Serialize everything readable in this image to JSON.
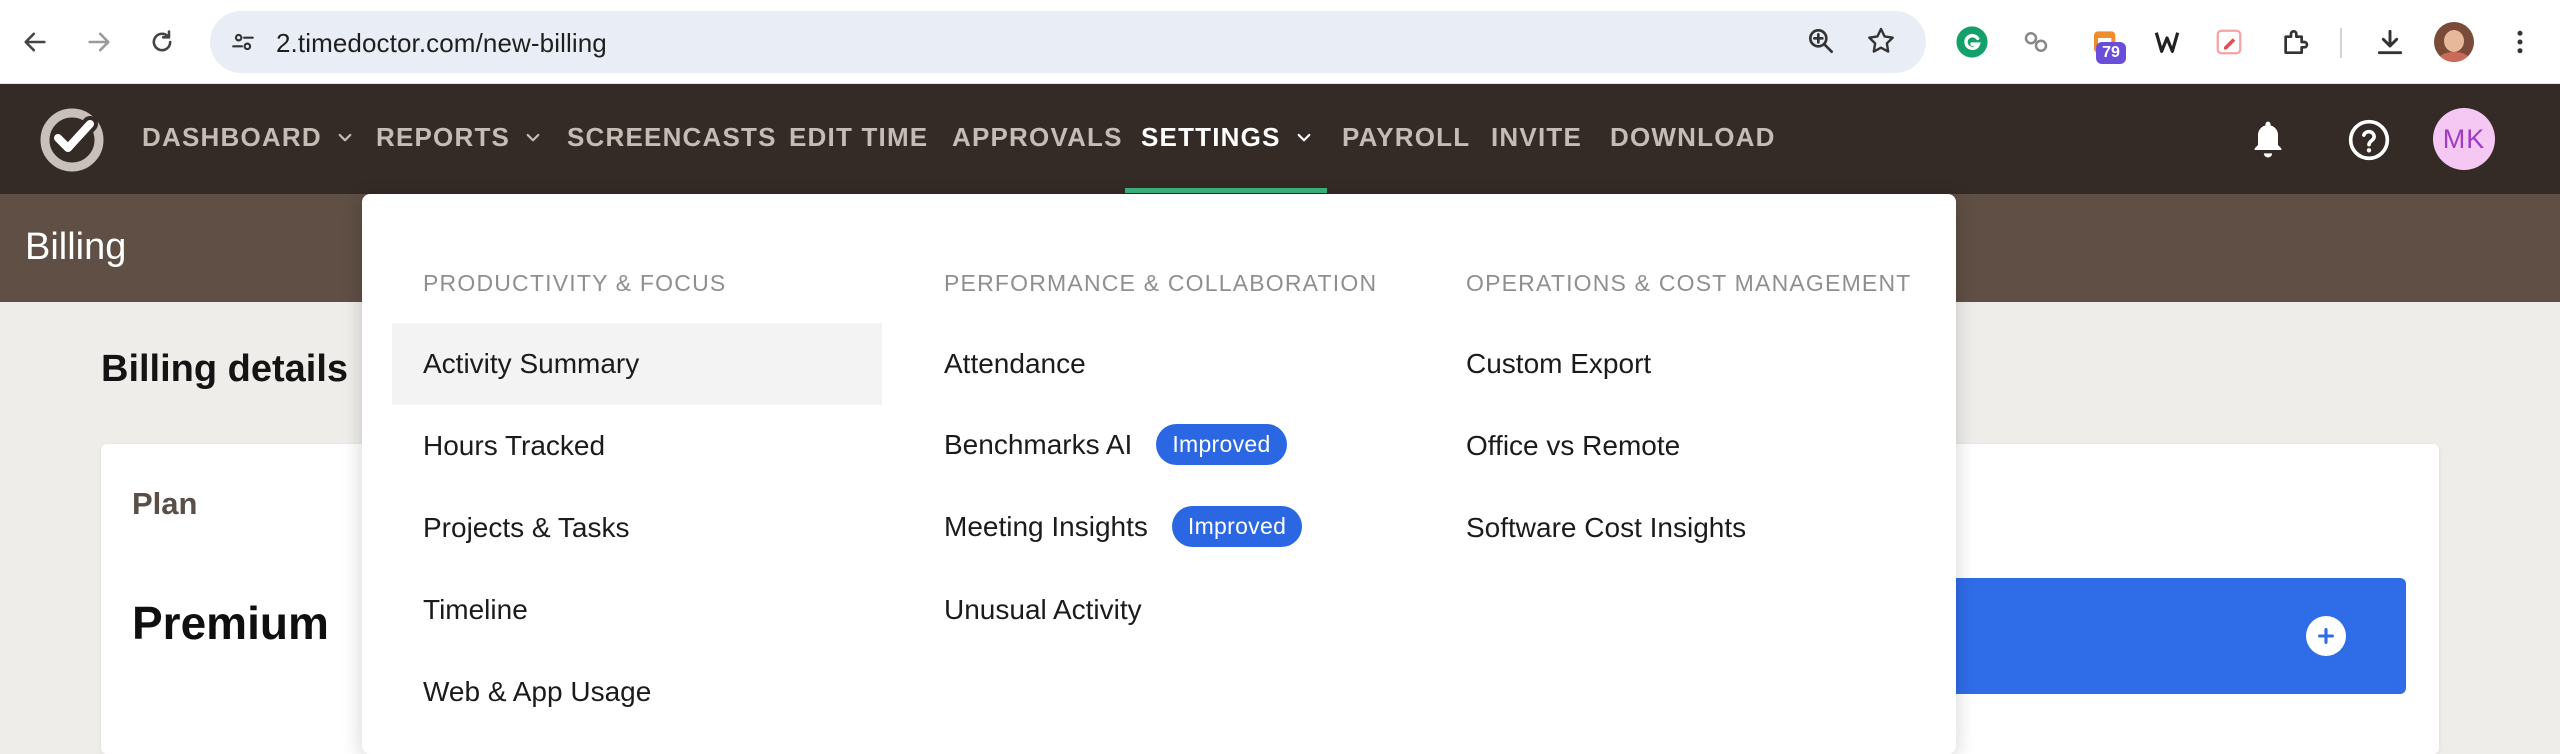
{
  "browser": {
    "url": "2.timedoctor.com/new-billing",
    "extension_badge": "79",
    "icons": [
      "back-icon",
      "forward-icon",
      "reload-icon",
      "site-info-icon",
      "zoom-icon",
      "star-icon",
      "grammarly-icon",
      "link-extension-icon",
      "calendar-extension-icon",
      "ticket-extension-icon",
      "pen-extension-icon",
      "puzzle-icon",
      "download-icon",
      "profile-avatar",
      "kebab-menu-icon"
    ]
  },
  "nav": {
    "items": [
      {
        "label": "DASHBOARD",
        "dropdown": true
      },
      {
        "label": "REPORTS",
        "dropdown": true
      },
      {
        "label": "SCREENCASTS",
        "dropdown": false
      },
      {
        "label": "EDIT TIME",
        "dropdown": false
      },
      {
        "label": "APPROVALS",
        "dropdown": false
      },
      {
        "label": "SETTINGS",
        "dropdown": true,
        "active": true
      },
      {
        "label": "PAYROLL",
        "dropdown": false
      },
      {
        "label": "INVITE",
        "dropdown": false
      },
      {
        "label": "DOWNLOAD",
        "dropdown": false
      }
    ],
    "avatar_initials": "MK",
    "accent_color": "#3cb47e"
  },
  "page": {
    "header_title": "Billing",
    "section_title": "Billing details",
    "plan_label": "Plan",
    "plan_name": "Premium"
  },
  "dropdown": {
    "columns": [
      {
        "heading": "PRODUCTIVITY & FOCUS",
        "items": [
          {
            "label": "Activity Summary",
            "highlighted": true
          },
          {
            "label": "Hours Tracked"
          },
          {
            "label": "Projects & Tasks"
          },
          {
            "label": "Timeline"
          },
          {
            "label": "Web & App Usage"
          }
        ]
      },
      {
        "heading": "PERFORMANCE & COLLABORATION",
        "items": [
          {
            "label": "Attendance"
          },
          {
            "label": "Benchmarks AI",
            "badge": "Improved"
          },
          {
            "label": "Meeting Insights",
            "badge": "Improved"
          },
          {
            "label": "Unusual Activity"
          }
        ]
      },
      {
        "heading": "OPERATIONS & COST MANAGEMENT",
        "items": [
          {
            "label": "Custom Export"
          },
          {
            "label": "Office vs Remote"
          },
          {
            "label": "Software Cost Insights"
          }
        ]
      }
    ],
    "badge_color": "#2b67e3"
  }
}
